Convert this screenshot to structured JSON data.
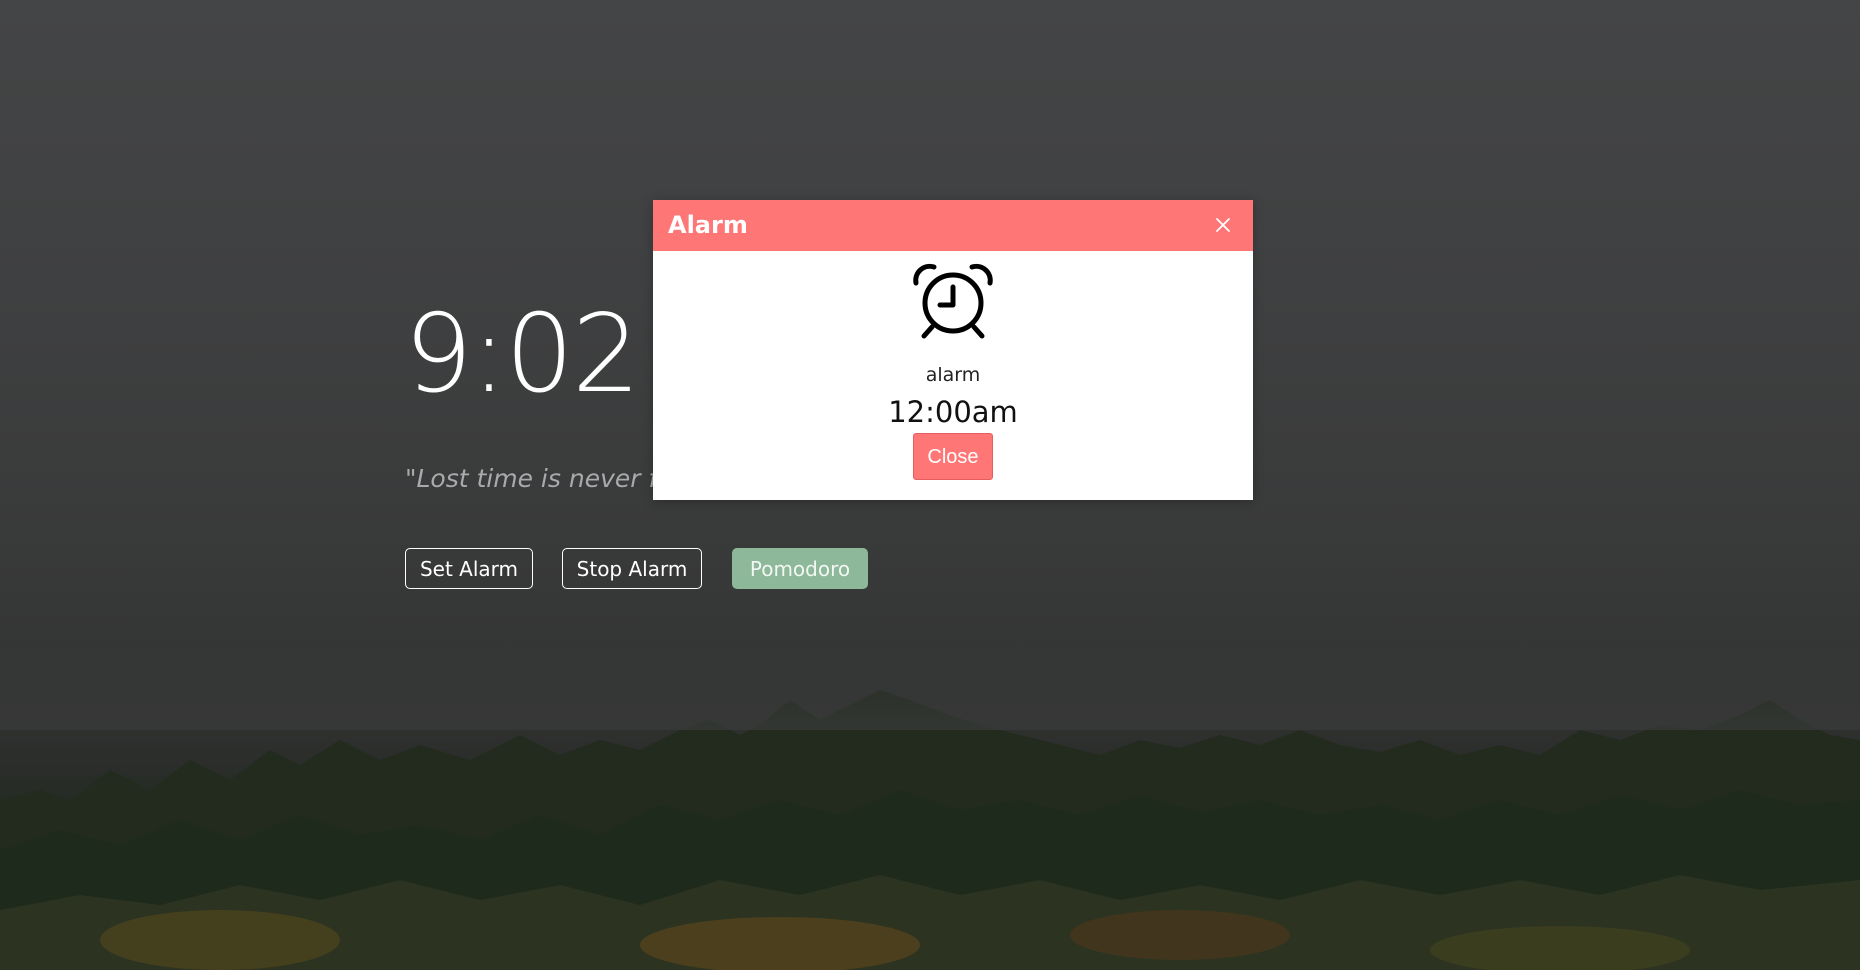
{
  "clock": {
    "time": "9:02:4"
  },
  "quote": {
    "text": "\"Lost time is never fou"
  },
  "actions": {
    "set_alarm_label": "Set Alarm",
    "stop_alarm_label": "Stop Alarm",
    "pomodoro_label": "Pomodoro"
  },
  "modal": {
    "title": "Alarm",
    "icon": "alarm-clock-icon",
    "alarm_name": "alarm",
    "alarm_time": "12:00am",
    "close_label": "Close"
  },
  "colors": {
    "modal_accent": "#fe7676",
    "pomodoro": "#8db899"
  }
}
